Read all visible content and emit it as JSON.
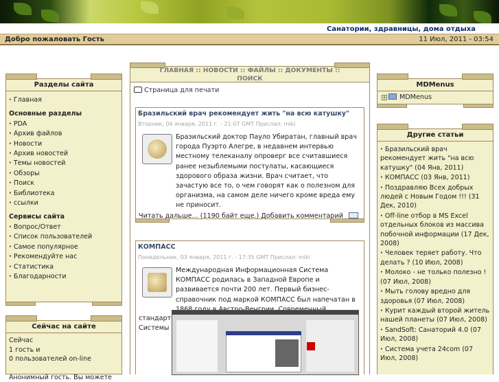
{
  "header": {
    "slogan": "Санатории, здравницы, дома отдыха",
    "welcome": "Добро пожаловать Гость",
    "datetime": "11 Июл, 2011 - 03:54"
  },
  "left": {
    "sections_title": "Разделы сайта",
    "home": "Главная",
    "main_sections_title": "Основные разделы",
    "main_items": [
      "PDA",
      "Архив файлов",
      "Новости",
      "Архив новостей",
      "Темы новостей",
      "Обзоры",
      "Поиск",
      "Библиотека",
      "ссылки"
    ],
    "services_title": "Сервисы сайта",
    "service_items": [
      "Вопрос/Ответ",
      "Список пользователей",
      "Самое популярное",
      "Рекомендуйте нас",
      "Статистика",
      "Благодарности"
    ],
    "online_title": "Сейчас на сайте",
    "online_lines": [
      "Сейчас",
      "1 гость и",
      "0 пользователей on-line",
      "",
      "Анонимный гость. Вы можете"
    ]
  },
  "center": {
    "menu": "ГЛАВНАЯ :: НОВОСТИ :: ФАЙЛЫ :: ДОКУМЕНТЫ :: ПОИСК",
    "print": "Страница для печати",
    "articles": [
      {
        "title": "Бразильский врач рекомендует жить \"на всю катушку\"",
        "meta": "Вторник, 04 января, 2011 г. - 21:07 GMT Прислал: miki",
        "body": "Бразильский доктор Пауло Убиратан, главный врач города Пуэрто Алегре, в недавнем интервью местному телеканалу опроверг все считавшиеся ранее незыблемыми постулаты, касающиеся здорового образа жизни. Врач считает, что зачастую все то, о чем говорят как о полезном для организма, на самом деле ничего кроме вреда ему не приносит.",
        "more": "Читать дальше... (1190 байт еще.) Добавить комментарий"
      },
      {
        "title": "КОМПАСС",
        "meta": "Понедельник, 03 января, 2011 г. - 17:35 GMT Прислал: miki",
        "body": "Международная Информационная Система КОМПАСС родилась в Западной Европе и развивается почти 200 лет. Первый бизнес-справочник под маркой КОМПАСС был напечатан в 1868 году в Австро-Венгрии. Современный",
        "tail1": "стандарт",
        "tail2": "Системы"
      }
    ]
  },
  "right": {
    "mdmenus_title": "MDMenus",
    "mdmenus_item": "MDMenus",
    "other_title": "Другие статьи",
    "articles": [
      "Бразильский врач рекомендует жить \"на всю катушку\" (04 Янв, 2011)",
      "КОМПАСС (03 Янв, 2011)",
      "Поздравляю Всех добрых людей с Новым Годом !!! (31 Дек, 2010)",
      "Off-line отбор в MS Excel отдельных блоков из массива побочной информации (17 Дек, 2008)",
      "Человек теряет работу. Что делать ? (10 Июл, 2008)",
      "Молоко - не только полезно ! (07 Июл, 2008)",
      "Мыть голову вредно для здоровья (07 Июл, 2008)",
      "Курит каждый второй житель нашей планеты (07 Июл, 2008)",
      "SandSoft: Санаторий 4.0 (07 Июл, 2008)",
      "Система учета 24com (07 Июл, 2008)"
    ]
  }
}
